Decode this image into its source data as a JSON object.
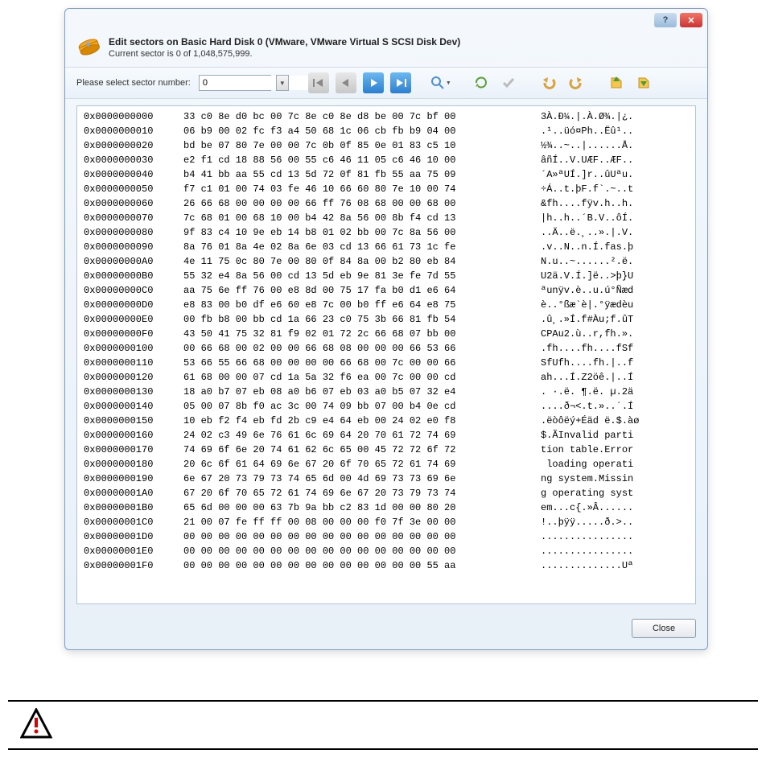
{
  "window": {
    "title": "Edit sectors on Basic Hard Disk 0 (VMware, VMware Virtual S SCSI Disk Dev)",
    "subtitle": "Current sector is 0 of 1,048,575,999."
  },
  "sector_select": {
    "label": "Please select sector number:",
    "value": "0"
  },
  "toolbar_icons": {
    "first": "first-icon",
    "prev": "prev-icon",
    "next": "next-icon",
    "last": "last-icon",
    "search": "search-icon",
    "refresh": "refresh-icon",
    "check": "check-icon",
    "undo": "undo-icon",
    "redo": "redo-icon",
    "import": "import-icon",
    "export": "export-icon"
  },
  "hex_rows": [
    {
      "o": "0x0000000000",
      "b": "33 c0 8e d0 bc 00 7c 8e c0 8e d8 be 00 7c bf 00",
      "a": "3À.Ð¼.|.À.Ø¾.|¿."
    },
    {
      "o": "0x0000000010",
      "b": "06 b9 00 02 fc f3 a4 50 68 1c 06 cb fb b9 04 00",
      "a": ".¹..üó¤Ph..Ëû¹.."
    },
    {
      "o": "0x0000000020",
      "b": "bd be 07 80 7e 00 00 7c 0b 0f 85 0e 01 83 c5 10",
      "a": "½¾..~..|......Å."
    },
    {
      "o": "0x0000000030",
      "b": "e2 f1 cd 18 88 56 00 55 c6 46 11 05 c6 46 10 00",
      "a": "âñÍ..V.UÆF..ÆF.."
    },
    {
      "o": "0x0000000040",
      "b": "b4 41 bb aa 55 cd 13 5d 72 0f 81 fb 55 aa 75 09",
      "a": "´A»ªUÍ.]r..ûUªu."
    },
    {
      "o": "0x0000000050",
      "b": "f7 c1 01 00 74 03 fe 46 10 66 60 80 7e 10 00 74",
      "a": "÷Á..t.þF.f`.~..t"
    },
    {
      "o": "0x0000000060",
      "b": "26 66 68 00 00 00 00 66 ff 76 08 68 00 00 68 00",
      "a": "&fh....fÿv.h..h."
    },
    {
      "o": "0x0000000070",
      "b": "7c 68 01 00 68 10 00 b4 42 8a 56 00 8b f4 cd 13",
      "a": "|h..h..´B.V..ôÍ."
    },
    {
      "o": "0x0000000080",
      "b": "9f 83 c4 10 9e eb 14 b8 01 02 bb 00 7c 8a 56 00",
      "a": "..Ä..ë.¸..».|.V."
    },
    {
      "o": "0x0000000090",
      "b": "8a 76 01 8a 4e 02 8a 6e 03 cd 13 66 61 73 1c fe",
      "a": ".v..N..n.Í.fas.þ"
    },
    {
      "o": "0x00000000A0",
      "b": "4e 11 75 0c 80 7e 00 80 0f 84 8a 00 b2 80 eb 84",
      "a": "N.u..~......².ë."
    },
    {
      "o": "0x00000000B0",
      "b": "55 32 e4 8a 56 00 cd 13 5d eb 9e 81 3e fe 7d 55",
      "a": "U2ä.V.Í.]ë..>þ}U"
    },
    {
      "o": "0x00000000C0",
      "b": "aa 75 6e ff 76 00 e8 8d 00 75 17 fa b0 d1 e6 64",
      "a": "ªunÿv.è..u.ú°Ñæd"
    },
    {
      "o": "0x00000000D0",
      "b": "e8 83 00 b0 df e6 60 e8 7c 00 b0 ff e6 64 e8 75",
      "a": "è..°ßæ`è|.°ÿædèu"
    },
    {
      "o": "0x00000000E0",
      "b": "00 fb b8 00 bb cd 1a 66 23 c0 75 3b 66 81 fb 54",
      "a": ".û¸.»Í.f#Àu;f.ûT"
    },
    {
      "o": "0x00000000F0",
      "b": "43 50 41 75 32 81 f9 02 01 72 2c 66 68 07 bb 00",
      "a": "CPAu2.ù..r,fh.»."
    },
    {
      "o": "0x0000000100",
      "b": "00 66 68 00 02 00 00 66 68 08 00 00 00 66 53 66",
      "a": ".fh....fh....fSf"
    },
    {
      "o": "0x0000000110",
      "b": "53 66 55 66 68 00 00 00 00 66 68 00 7c 00 00 66",
      "a": "SfUfh....fh.|..f"
    },
    {
      "o": "0x0000000120",
      "b": "61 68 00 00 07 cd 1a 5a 32 f6 ea 00 7c 00 00 cd",
      "a": "ah...Í.Z2öê.|..Í"
    },
    {
      "o": "0x0000000130",
      "b": "18 a0 b7 07 eb 08 a0 b6 07 eb 03 a0 b5 07 32 e4",
      "a": ". ·.ë. ¶.ë. µ.2ä"
    },
    {
      "o": "0x0000000140",
      "b": "05 00 07 8b f0 ac 3c 00 74 09 bb 07 00 b4 0e cd",
      "a": "....ð¬<.t.»..´.Í"
    },
    {
      "o": "0x0000000150",
      "b": "10 eb f2 f4 eb fd 2b c9 e4 64 eb 00 24 02 e0 f8",
      "a": ".ëòôëý+Éäd ë.$.àø"
    },
    {
      "o": "0x0000000160",
      "b": "24 02 c3 49 6e 76 61 6c 69 64 20 70 61 72 74 69",
      "a": "$.ÃInvalid parti"
    },
    {
      "o": "0x0000000170",
      "b": "74 69 6f 6e 20 74 61 62 6c 65 00 45 72 72 6f 72",
      "a": "tion table.Error"
    },
    {
      "o": "0x0000000180",
      "b": "20 6c 6f 61 64 69 6e 67 20 6f 70 65 72 61 74 69",
      "a": " loading operati"
    },
    {
      "o": "0x0000000190",
      "b": "6e 67 20 73 79 73 74 65 6d 00 4d 69 73 73 69 6e",
      "a": "ng system.Missin"
    },
    {
      "o": "0x00000001A0",
      "b": "67 20 6f 70 65 72 61 74 69 6e 67 20 73 79 73 74",
      "a": "g operating syst"
    },
    {
      "o": "0x00000001B0",
      "b": "65 6d 00 00 00 63 7b 9a bb c2 83 1d 00 00 80 20",
      "a": "em...c{.»Â...... "
    },
    {
      "o": "0x00000001C0",
      "b": "21 00 07 fe ff ff 00 08 00 00 00 f0 7f 3e 00 00",
      "a": "!..þÿÿ.....ð.>.."
    },
    {
      "o": "0x00000001D0",
      "b": "00 00 00 00 00 00 00 00 00 00 00 00 00 00 00 00",
      "a": "................"
    },
    {
      "o": "0x00000001E0",
      "b": "00 00 00 00 00 00 00 00 00 00 00 00 00 00 00 00",
      "a": "................"
    },
    {
      "o": "0x00000001F0",
      "b": "00 00 00 00 00 00 00 00 00 00 00 00 00 00 55 aa",
      "a": "..............Uª"
    }
  ],
  "footer": {
    "close": "Close"
  }
}
